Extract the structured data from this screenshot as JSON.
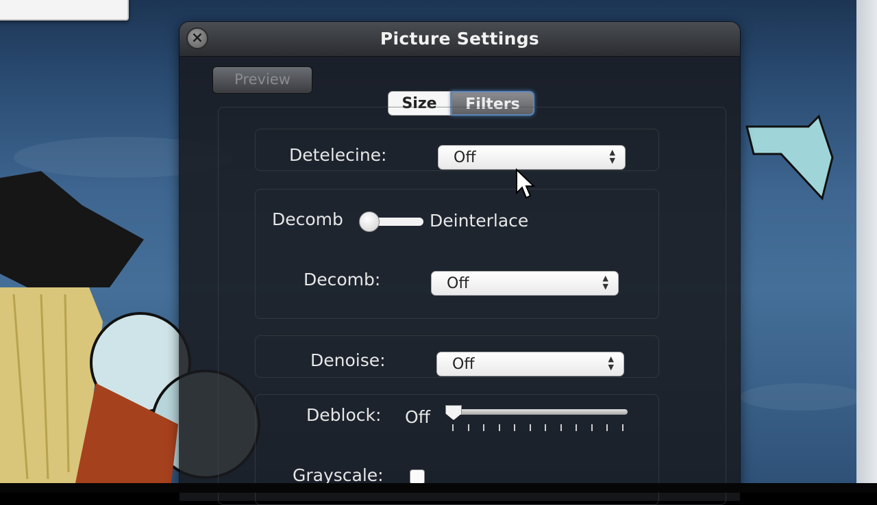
{
  "window": {
    "title": "Picture Settings"
  },
  "toolbar": {
    "preview_label": "Preview"
  },
  "tabs": [
    {
      "label": "Size",
      "selected": false
    },
    {
      "label": "Filters",
      "selected": true
    }
  ],
  "filters": {
    "detelecine": {
      "label": "Detelecine:",
      "value": "Off"
    },
    "decomb_toggle": {
      "left_label": "Decomb",
      "right_label": "Deinterlace",
      "position": "Decomb"
    },
    "decomb": {
      "label": "Decomb:",
      "value": "Off"
    },
    "denoise": {
      "label": "Denoise:",
      "value": "Off"
    },
    "deblock": {
      "label": "Deblock:",
      "value_text": "Off",
      "level": 0
    },
    "grayscale": {
      "label": "Grayscale:",
      "checked": false
    }
  },
  "colors": {
    "accent": "#5d86b8",
    "panel": "#18191d",
    "text": "#e6e6e6"
  }
}
